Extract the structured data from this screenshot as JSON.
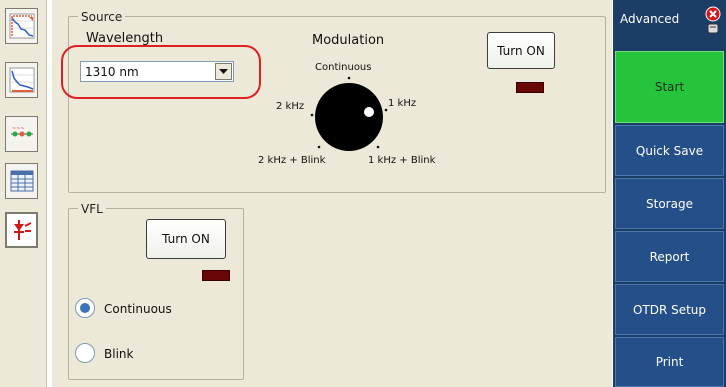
{
  "source": {
    "group_label": "Source",
    "wavelength_label": "Wavelength",
    "wavelength_value": "1310 nm",
    "modulation_label": "Modulation",
    "turn_on_label": "Turn ON",
    "knob_options": {
      "continuous": "Continuous",
      "khz2": "2 kHz",
      "khz1": "1 kHz",
      "khz2_blink": "2 kHz + Blink",
      "khz1_blink": "1 kHz + Blink"
    }
  },
  "vfl": {
    "group_label": "VFL",
    "turn_on_label": "Turn ON",
    "options": [
      {
        "label": "Continuous",
        "selected": true
      },
      {
        "label": "Blink",
        "selected": false
      }
    ]
  },
  "right_panel": {
    "mode_label": "Advanced",
    "buttons": [
      {
        "label": "Start"
      },
      {
        "label": "Quick Save"
      },
      {
        "label": "Storage"
      },
      {
        "label": "Report"
      },
      {
        "label": "OTDR Setup"
      },
      {
        "label": "Print"
      }
    ]
  },
  "toolbar": {
    "icons": [
      "trace-zoom-icon",
      "trace-view-icon",
      "event-markers-icon",
      "table-icon",
      "laser-source-icon"
    ]
  },
  "colors": {
    "highlight_ring": "#e02020",
    "start_button": "#26c43a",
    "right_panel_bg": "#1b3d66",
    "led_off": "#6a0606"
  }
}
